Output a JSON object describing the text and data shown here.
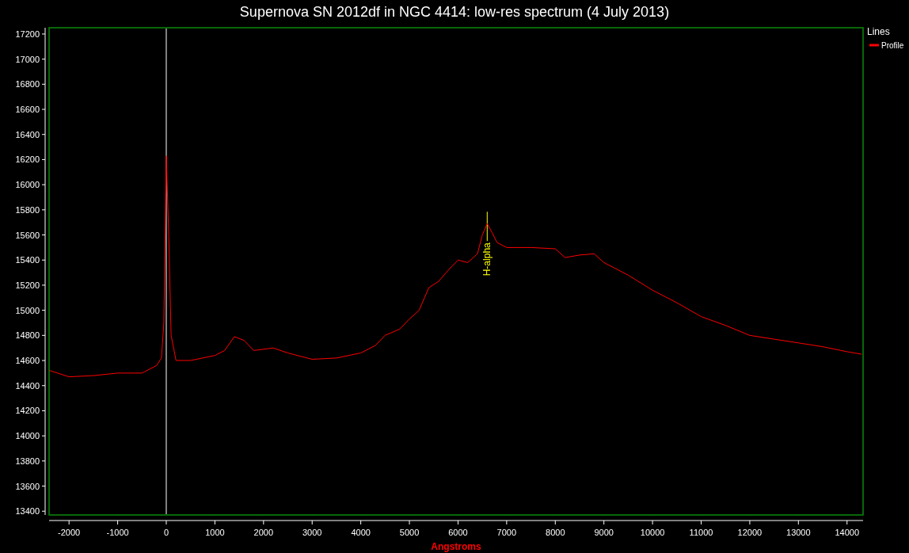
{
  "window": {
    "title": "Supernova SN 2012df in NGC 4414: low-res spectrum (4 July 2013)"
  },
  "chart": {
    "chart_data": {
      "type": "line",
      "xlabel": "Angstroms",
      "xlim": [
        -2410,
        14330
      ],
      "ylim": [
        13370,
        17250
      ],
      "xticks": [
        -2000,
        -1000,
        0,
        1000,
        2000,
        3000,
        4000,
        5000,
        6000,
        7000,
        8000,
        9000,
        10000,
        11000,
        12000,
        13000,
        14000
      ],
      "yticks": [
        13400,
        13600,
        13800,
        14000,
        14200,
        14400,
        14600,
        14800,
        15000,
        15200,
        15400,
        15600,
        15800,
        16000,
        16200,
        16400,
        16600,
        16800,
        17000,
        17200
      ],
      "x": [
        -2400,
        -2000,
        -1500,
        -1000,
        -500,
        -200,
        -100,
        -50,
        0,
        50,
        100,
        200,
        500,
        1000,
        1200,
        1400,
        1600,
        1800,
        2000,
        2200,
        2500,
        3000,
        3500,
        4000,
        4300,
        4500,
        4800,
        5000,
        5200,
        5400,
        5600,
        5800,
        6000,
        6200,
        6400,
        6500,
        6600,
        6700,
        6800,
        7000,
        7500,
        8000,
        8200,
        8500,
        8800,
        9000,
        9500,
        10000,
        10500,
        11000,
        11500,
        12000,
        12500,
        13000,
        13500,
        14000,
        14300
      ],
      "series": [
        {
          "name": "Profile",
          "color": "#ff0000",
          "values": [
            14520,
            14470,
            14480,
            14500,
            14500,
            14560,
            14620,
            14900,
            16230,
            15600,
            14800,
            14600,
            14600,
            14640,
            14680,
            14790,
            14760,
            14680,
            14690,
            14700,
            14660,
            14610,
            14620,
            14660,
            14720,
            14800,
            14850,
            14930,
            15000,
            15180,
            15230,
            15320,
            15400,
            15380,
            15450,
            15600,
            15690,
            15620,
            15540,
            15500,
            15500,
            15490,
            15420,
            15440,
            15450,
            15380,
            15280,
            15160,
            15060,
            14950,
            14880,
            14800,
            14770,
            14740,
            14710,
            14670,
            14650
          ]
        }
      ],
      "ref_lines": [
        {
          "axis": "x",
          "value": 0
        }
      ],
      "annotations": [
        "H-alpha"
      ]
    },
    "legend": {
      "title": "Lines"
    }
  }
}
